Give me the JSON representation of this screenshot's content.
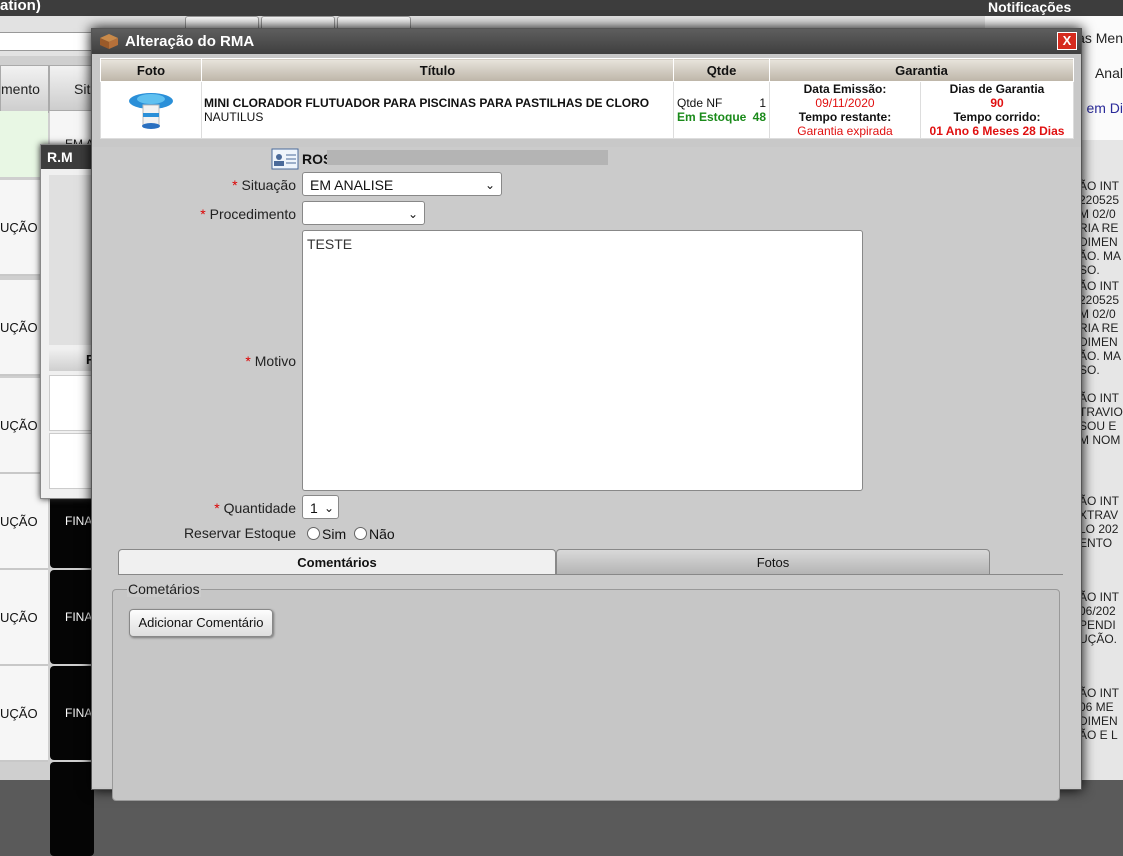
{
  "background": {
    "title": "ation)",
    "columns": [
      "mento",
      "Sit"
    ],
    "row_situation": "UÇÃO",
    "row_dark": "FINA",
    "em_text": "EM A",
    "rm_window_title": "R.M",
    "rm_header": "F"
  },
  "notifications": {
    "title": "Notificações",
    "links": [
      "as Men",
      "Anal",
      "em Di"
    ],
    "items": [
      "ÃO INT\n220525\nM 02/0\nRIA RE\nDIMEN\nÃO. MA\nSO.",
      "ÃO INT\n220525\nM 02/0\nRIA RE\nDIMEN\nÃO. MA\nSO.",
      "ÃO INT\nTRAVIO\nSOU E\nM NOM",
      "ÃO INT\nXTRAV\nLO 202\nENTO",
      "ÃO INT\n06/202\nPENDI\nUÇÃO.",
      "ÃO INT\n06 ME\nDIMEN\nÃO E L"
    ]
  },
  "modal": {
    "title": "Alteração do RMA",
    "close": "X",
    "table": {
      "headers": [
        "Foto",
        "Título",
        "Qtde",
        "Garantia"
      ],
      "product_title": "MINI CLORADOR FLUTUADOR PARA PISCINAS PARA PASTILHAS DE CLORO",
      "product_brand": "NAUTILUS",
      "qtde_nf_label": "Qtde NF",
      "qtde_nf_value": "1",
      "estoque_label": "Em Estoque",
      "estoque_value": "48",
      "data_emissao_label": "Data Emissão:",
      "data_emissao_value": "09/11/2020",
      "tempo_restante_label": "Tempo restante:",
      "tempo_restante_value": "Garantia expirada",
      "dias_garantia_label": "Dias de Garantia",
      "dias_garantia_value": "90",
      "tempo_corrido_label": "Tempo corrido:",
      "tempo_corrido_value": "01 Ano 6 Meses 28 Dias"
    },
    "form": {
      "client_name": "ROS",
      "situacao_label": "Situação",
      "situacao_value": "EM ANALISE",
      "procedimento_label": "Procedimento",
      "procedimento_value": "",
      "motivo_label": "Motivo",
      "motivo_value": "TESTE",
      "quantidade_label": "Quantidade",
      "quantidade_value": "1",
      "reservar_label": "Reservar Estoque",
      "sim": "Sim",
      "nao": "Não",
      "required_mark": "*"
    },
    "tabs": [
      "Comentários",
      "Fotos"
    ],
    "comentarios": {
      "legend": "Cometários",
      "add_button": "Adicionar Comentário"
    }
  },
  "colors": {
    "header_dark": "#3d3d3d",
    "close_red": "#d62b1e",
    "stock_green": "#1a8a1a",
    "warning_red": "#e01010"
  }
}
